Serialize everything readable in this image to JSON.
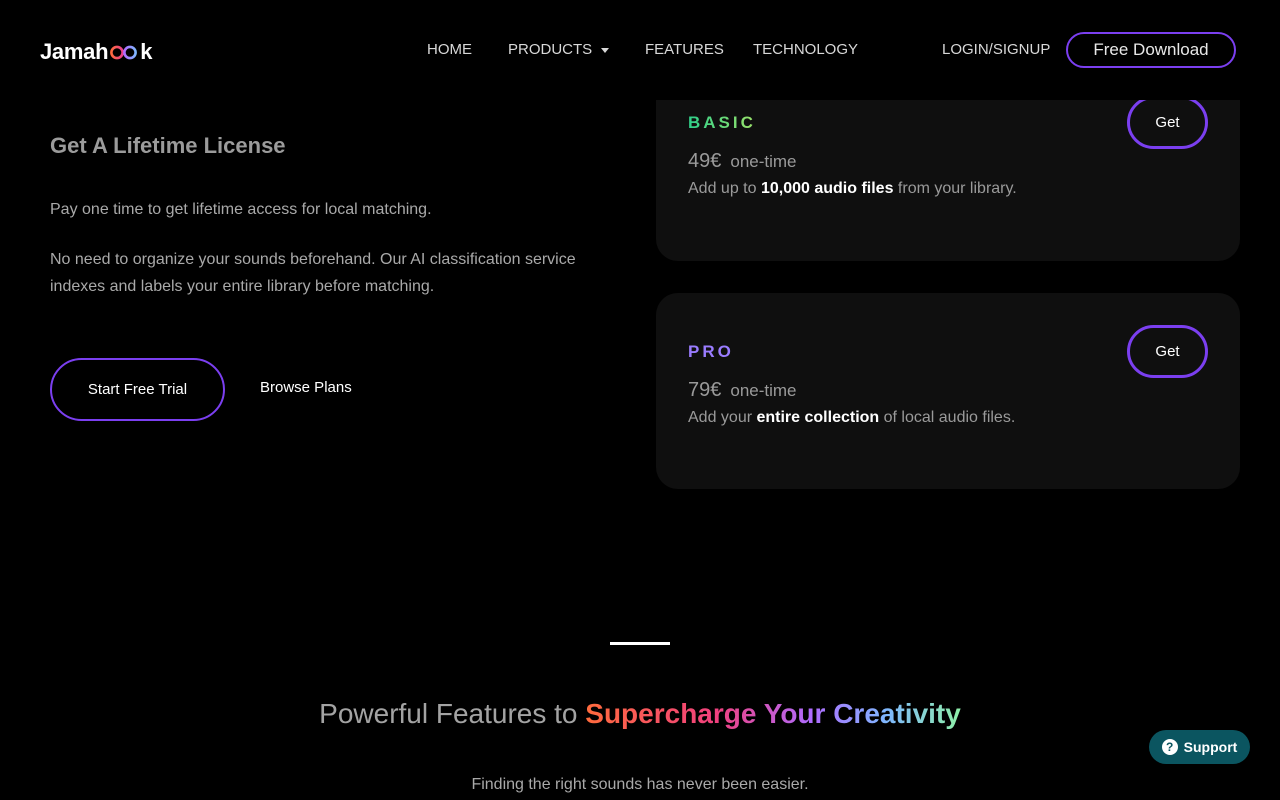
{
  "header": {
    "logo_prefix": "Jamah",
    "logo_suffix": "k",
    "nav": [
      {
        "label": "HOME"
      },
      {
        "label": "PRODUCTS"
      },
      {
        "label": "FEATURES"
      },
      {
        "label": "TECHNOLOGY"
      }
    ],
    "login_label": "LOGIN/SIGNUP",
    "download_label": "Free Download"
  },
  "license": {
    "title": "Get A Lifetime License",
    "paragraph1": "Pay one time to get lifetime access for local matching.",
    "paragraph2": "No need to organize your sounds beforehand. Our AI classification service indexes and labels your entire library before matching.",
    "start_trial_label": "Start Free Trial",
    "browse_plans_label": "Browse Plans"
  },
  "plans": [
    {
      "name": "BASIC",
      "price": "49€",
      "term": "one-time",
      "desc_before": "Add up to ",
      "desc_bold": "10,000 audio files",
      "desc_after": " from your library.",
      "get_label": "Get"
    },
    {
      "name": "PRO",
      "price": "79€",
      "term": "one-time",
      "desc_before": "Add your ",
      "desc_bold": "entire collection",
      "desc_after": " of local audio files.",
      "get_label": "Get"
    }
  ],
  "features": {
    "heading_plain": "Powerful Features to ",
    "heading_gradient": "Supercharge Your Creativity",
    "subtitle": "Finding the right sounds has never been easier."
  },
  "support": {
    "label": "Support",
    "icon_glyph": "?"
  },
  "colors": {
    "background": "#000000",
    "accent_purple": "#7b3ff0",
    "basic_gradient": [
      "#2fd08a",
      "#9be26a"
    ],
    "pro_color": "#9a7cff",
    "support_bg": "#0b5560"
  },
  "icons": {
    "logo_rings": "logo-rings-icon",
    "products_caret": "caret-down-icon",
    "support": "question-circle-icon"
  }
}
